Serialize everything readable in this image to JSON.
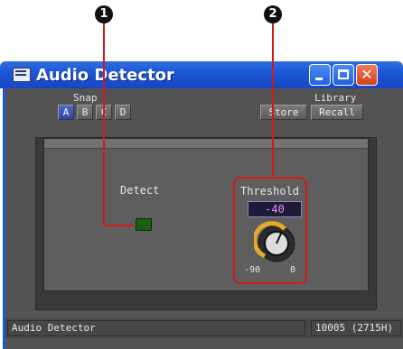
{
  "callouts": {
    "one": "1",
    "two": "2"
  },
  "window": {
    "title": "Audio Detector",
    "controls": {
      "minimize": "minimize",
      "maximize": "maximize",
      "close": "close"
    }
  },
  "snap": {
    "label": "Snap",
    "buttons": [
      "A",
      "B",
      "C",
      "D"
    ],
    "active_index": 0
  },
  "library": {
    "label": "Library",
    "store": "Store",
    "recall": "Recall"
  },
  "detect": {
    "label": "Detect",
    "state": "off"
  },
  "threshold": {
    "label": "Threshold",
    "value": "-40",
    "min_label": "-90",
    "max_label": "0",
    "min": -90,
    "max": 0,
    "current": -40
  },
  "status": {
    "name": "Audio Detector",
    "id": "10005 (2715H)"
  },
  "colors": {
    "titlebar": "#1c57d6",
    "callout": "#d11a1a",
    "knob_ring": "#e6a82a",
    "value_text": "#f08af0"
  }
}
